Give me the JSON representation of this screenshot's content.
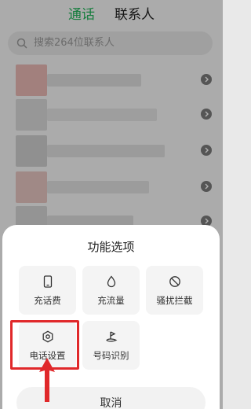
{
  "tabs": [
    {
      "label": "通话",
      "active": true
    },
    {
      "label": "联系人",
      "active": false
    }
  ],
  "search": {
    "placeholder": "搜索264位联系人"
  },
  "sheet": {
    "title": "功能选项",
    "options": [
      {
        "label": "充话费",
        "icon": "phone-icon"
      },
      {
        "label": "充流量",
        "icon": "water-drop-icon"
      },
      {
        "label": "骚扰拦截",
        "icon": "block-icon"
      },
      {
        "label": "电话设置",
        "icon": "gear-icon"
      },
      {
        "label": "号码识别",
        "icon": "location-pin-icon"
      }
    ],
    "cancel_label": "取消"
  },
  "colors": {
    "accent": "#21b35a",
    "highlight": "#e0282a"
  }
}
